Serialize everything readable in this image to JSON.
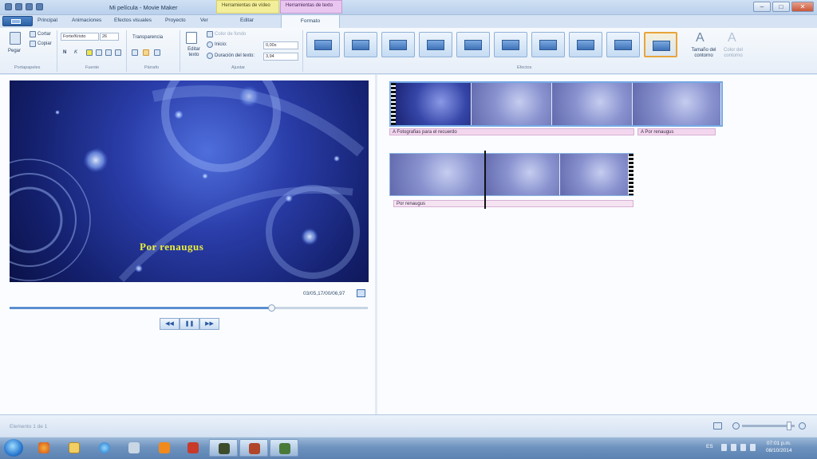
{
  "window": {
    "title": "Mi película - Movie Maker"
  },
  "context_tabs": {
    "video_tools": "Herramientas de vídeo",
    "text_tools": "Herramientas de texto"
  },
  "tabs": [
    "Principal",
    "Animaciones",
    "Efectos visuales",
    "Proyecto",
    "Ver",
    "Editar",
    "Formato"
  ],
  "active_tab": "Formato",
  "ribbon": {
    "clipboard": {
      "paste": "Pegar",
      "cut": "Cortar",
      "copy": "Copiar",
      "label": "Portapapeles"
    },
    "font": {
      "family": "Forte/Kristo",
      "size": "26",
      "bold": "N",
      "italic": "K",
      "label": "Fuente",
      "transparency": "Transparencia"
    },
    "paragraph": {
      "label": "Párrafo"
    },
    "adjust": {
      "edit_text": "Editar texto",
      "background_color": "Color de fondo",
      "start_label": "Inicio:",
      "start_value": "0,00s",
      "duration_label": "Duración del texto:",
      "duration_value": "3,94",
      "label": "Ajustar"
    },
    "effects": {
      "label": "Efectos",
      "count": 10,
      "selected_index": 10
    },
    "outline": {
      "size": "Tamaño del contorno",
      "color": "Color del contorno"
    }
  },
  "preview": {
    "caption": "Por renaugus",
    "timecode": "03/05,17/00/06,97",
    "progress": 0.73,
    "controls": {
      "previous": "◀◀",
      "pause": "❚❚",
      "next": "▶▶"
    }
  },
  "storyboard": {
    "clips": [
      {
        "title_caption": "Fotografias para el recuerdo",
        "overlay_caption": "Por renaugus"
      },
      {
        "title_caption": "Por renaugus"
      }
    ]
  },
  "status": {
    "text": "Elemento 1 de 1",
    "zoom": 0.9
  },
  "taskbar": {
    "lang": "ES",
    "time": "07:01 p.m.",
    "date": "08/10/2014"
  },
  "colors": {
    "caption": "#ecef3a",
    "accent": "#2a5fa3",
    "video_tools": "#f3ee9a",
    "text_tools": "#e8c6f0"
  }
}
